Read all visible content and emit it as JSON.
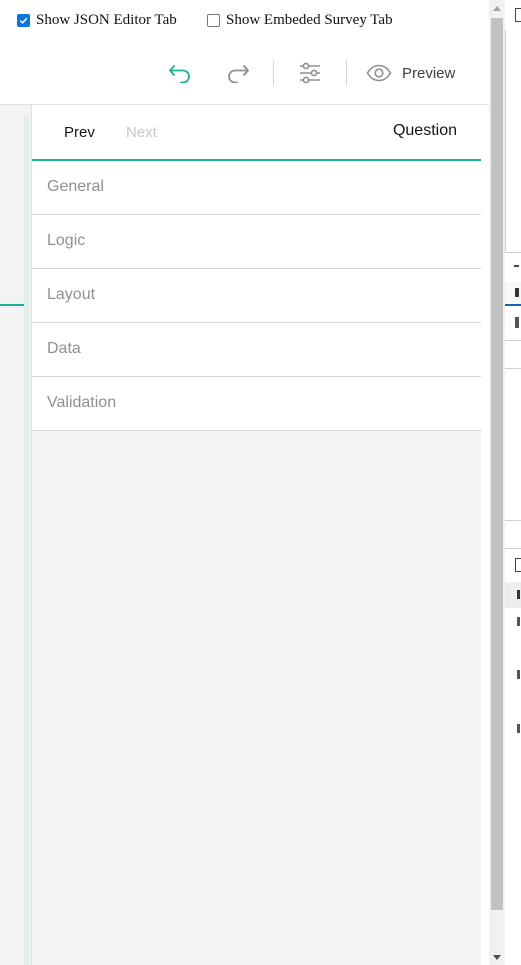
{
  "options": {
    "json_editor_label": "Show JSON Editor Tab",
    "json_editor_checked": true,
    "embedded_survey_label": "Show Embeded Survey Tab",
    "embedded_survey_checked": false
  },
  "toolbar": {
    "undo_icon": "undo-icon",
    "redo_icon": "redo-icon",
    "settings_icon": "settings-sliders-icon",
    "preview_label": "Preview",
    "preview_icon": "eye-icon"
  },
  "property_grid": {
    "prev_label": "Prev",
    "next_label": "Next",
    "title": "Question",
    "categories": [
      "General",
      "Logic",
      "Layout",
      "Data",
      "Validation"
    ]
  },
  "colors": {
    "accent": "#19b394",
    "checkbox": "#0b75e8",
    "background": "#f3f3f3"
  }
}
